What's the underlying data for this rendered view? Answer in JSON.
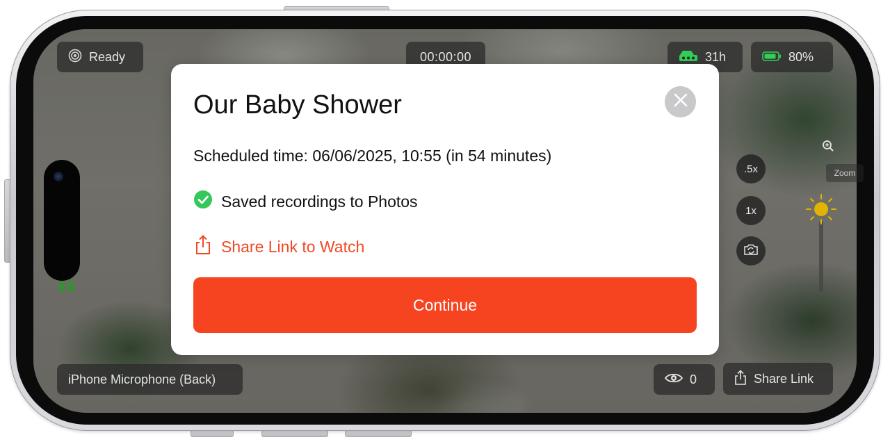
{
  "status": {
    "ready_label": "Ready",
    "timer": "00:00:00",
    "hours_remaining": "31h",
    "battery": "80%"
  },
  "bottom_bar": {
    "microphone": "iPhone Microphone (Back)",
    "viewer_count": "0",
    "share_link_label": "Share Link"
  },
  "camera_controls": {
    "zoom_half": ".5x",
    "zoom_one": "1x",
    "zoom_label": "Zoom"
  },
  "modal": {
    "title": "Our Baby Shower",
    "schedule_text": "Scheduled time: 06/06/2025, 10:55 (in 54 minutes)",
    "saved_text": "Saved recordings to Photos",
    "share_text": "Share Link to Watch",
    "continue_label": "Continue"
  },
  "colors": {
    "accent": "#f74420",
    "link": "#f04a24",
    "success": "#34c759",
    "battery": "#30d158"
  }
}
